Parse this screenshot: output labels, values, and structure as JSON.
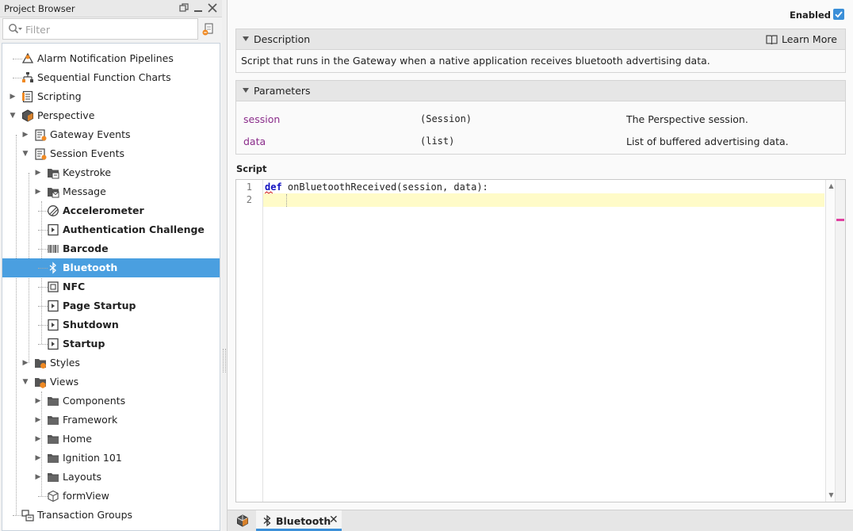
{
  "project_browser": {
    "title": "Project Browser",
    "header_icons": [
      "restore-icon",
      "minimize-icon",
      "close-icon"
    ],
    "filter": {
      "placeholder": "Filter",
      "value": ""
    },
    "tree": [
      {
        "label": "Alarm Notification Pipelines",
        "icon": "alarm-pipeline-icon",
        "bold": false,
        "expandable": false,
        "expanded": false,
        "selected": false
      },
      {
        "label": "Sequential Function Charts",
        "icon": "sfc-icon",
        "bold": false,
        "expandable": false,
        "expanded": false,
        "selected": false
      },
      {
        "label": "Scripting",
        "icon": "scripting-icon",
        "bold": false,
        "expandable": true,
        "expanded": false,
        "selected": false
      },
      {
        "label": "Perspective",
        "icon": "perspective-icon",
        "bold": false,
        "expandable": true,
        "expanded": true,
        "selected": false
      },
      {
        "label": "Gateway Events",
        "icon": "gateway-events-icon",
        "bold": false,
        "expandable": true,
        "expanded": false,
        "selected": false
      },
      {
        "label": "Session Events",
        "icon": "session-events-icon",
        "bold": false,
        "expandable": true,
        "expanded": true,
        "selected": false
      },
      {
        "label": "Keystroke",
        "icon": "keystroke-folder-icon",
        "bold": false,
        "expandable": true,
        "expanded": false,
        "selected": false
      },
      {
        "label": "Message",
        "icon": "message-folder-icon",
        "bold": false,
        "expandable": true,
        "expanded": false,
        "selected": false
      },
      {
        "label": "Accelerometer",
        "icon": "accelerometer-icon",
        "bold": true,
        "expandable": false,
        "expanded": false,
        "selected": false
      },
      {
        "label": "Authentication Challenge",
        "icon": "script-event-icon",
        "bold": true,
        "expandable": false,
        "expanded": false,
        "selected": false
      },
      {
        "label": "Barcode",
        "icon": "barcode-icon",
        "bold": true,
        "expandable": false,
        "expanded": false,
        "selected": false
      },
      {
        "label": "Bluetooth",
        "icon": "bluetooth-icon",
        "bold": true,
        "expandable": false,
        "expanded": false,
        "selected": true
      },
      {
        "label": "NFC",
        "icon": "nfc-icon",
        "bold": true,
        "expandable": false,
        "expanded": false,
        "selected": false
      },
      {
        "label": "Page Startup",
        "icon": "script-event-icon",
        "bold": true,
        "expandable": false,
        "expanded": false,
        "selected": false
      },
      {
        "label": "Shutdown",
        "icon": "script-event-icon",
        "bold": true,
        "expandable": false,
        "expanded": false,
        "selected": false
      },
      {
        "label": "Startup",
        "icon": "script-event-icon",
        "bold": true,
        "expandable": false,
        "expanded": false,
        "selected": false
      },
      {
        "label": "Styles",
        "icon": "styles-folder-icon",
        "bold": false,
        "expandable": true,
        "expanded": false,
        "selected": false
      },
      {
        "label": "Views",
        "icon": "views-folder-icon",
        "bold": false,
        "expandable": true,
        "expanded": true,
        "selected": false
      },
      {
        "label": "Components",
        "icon": "folder-icon",
        "bold": false,
        "expandable": true,
        "expanded": false,
        "selected": false
      },
      {
        "label": "Framework",
        "icon": "folder-icon",
        "bold": false,
        "expandable": true,
        "expanded": false,
        "selected": false
      },
      {
        "label": "Home",
        "icon": "folder-icon",
        "bold": false,
        "expandable": true,
        "expanded": false,
        "selected": false
      },
      {
        "label": "Ignition 101",
        "icon": "folder-icon",
        "bold": false,
        "expandable": true,
        "expanded": false,
        "selected": false
      },
      {
        "label": "Layouts",
        "icon": "folder-icon",
        "bold": false,
        "expandable": true,
        "expanded": false,
        "selected": false
      },
      {
        "label": "formView",
        "icon": "view-icon",
        "bold": false,
        "expandable": false,
        "expanded": false,
        "selected": false
      },
      {
        "label": "Transaction Groups",
        "icon": "transaction-groups-icon",
        "bold": false,
        "expandable": false,
        "expanded": false,
        "selected": false
      }
    ]
  },
  "editor": {
    "enabled_label": "Enabled",
    "enabled_checked": true,
    "description": {
      "title": "Description",
      "learn_more": "Learn More",
      "text": "Script that runs in the Gateway when a native application receives bluetooth advertising data."
    },
    "parameters": {
      "title": "Parameters",
      "rows": [
        {
          "name": "session",
          "type": "(Session)",
          "description": "The Perspective session."
        },
        {
          "name": "data",
          "type": "(list)",
          "description": "List of buffered advertising data."
        }
      ]
    },
    "script": {
      "label": "Script",
      "line_numbers": [
        "1",
        "2"
      ],
      "keyword": "def",
      "signature": " onBluetoothReceived(session, data):"
    }
  },
  "tabs": {
    "active": {
      "label": "Bluetooth",
      "icon": "bluetooth-icon"
    }
  },
  "colors": {
    "accent": "#3b8fd8",
    "selection": "#4a9fe0",
    "param_name": "#8a2c8a",
    "keyword": "#1010c0",
    "current_line": "#fffbc8"
  }
}
